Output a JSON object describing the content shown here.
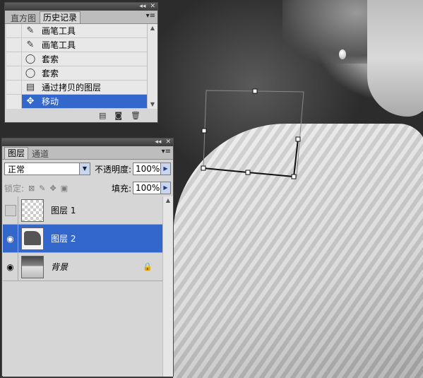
{
  "history": {
    "tabs": [
      {
        "label": "直方图",
        "active": false
      },
      {
        "label": "历史记录",
        "active": true
      }
    ],
    "items": [
      {
        "label": "画笔工具",
        "icon": "brush-icon",
        "glyph": "✎"
      },
      {
        "label": "画笔工具",
        "icon": "brush-icon",
        "glyph": "✎"
      },
      {
        "label": "套索",
        "icon": "lasso-icon",
        "glyph": "◯"
      },
      {
        "label": "套索",
        "icon": "lasso-icon",
        "glyph": "◯"
      },
      {
        "label": "通过拷贝的图层",
        "icon": "document-icon",
        "glyph": "▤"
      },
      {
        "label": "移动",
        "icon": "move-icon",
        "glyph": "✥",
        "selected": true
      }
    ],
    "footer_icons": [
      "new-document-icon",
      "camera-icon",
      "trash-icon"
    ]
  },
  "layers": {
    "tabs": [
      {
        "label": "图层",
        "active": true
      },
      {
        "label": "通道",
        "active": false
      }
    ],
    "blend_mode": "正常",
    "opacity_label": "不透明度:",
    "opacity_value": "100%",
    "lock_label": "锁定:",
    "fill_label": "填充:",
    "fill_value": "100%",
    "items": [
      {
        "name": "图层 1",
        "visible": false,
        "thumb": "transparent",
        "selected": false
      },
      {
        "name": "图层 2",
        "visible": true,
        "thumb": "mask",
        "selected": true
      },
      {
        "name": "背景",
        "visible": true,
        "thumb": "photo",
        "selected": false,
        "locked": true
      }
    ]
  },
  "colors": {
    "selection": "#3367cc",
    "panel_bg": "#d6d6d6"
  }
}
